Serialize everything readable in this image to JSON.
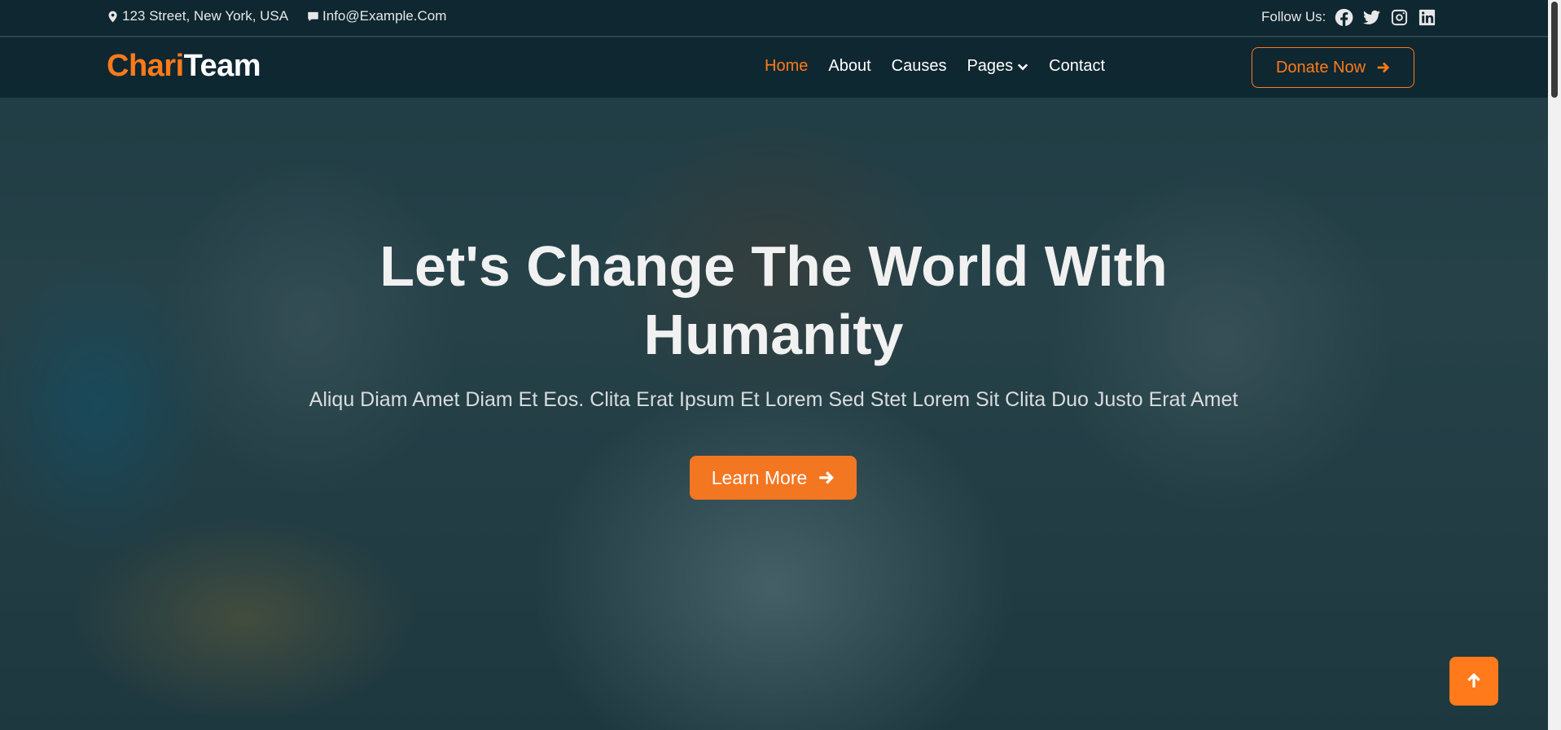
{
  "topbar": {
    "address": "123 Street, New York, USA",
    "email": "Info@Example.Com",
    "follow_label": "Follow Us:"
  },
  "logo": {
    "part1": "Chari",
    "part2": "Team"
  },
  "nav": {
    "home": "Home",
    "about": "About",
    "causes": "Causes",
    "pages": "Pages",
    "contact": "Contact",
    "donate": "Donate Now"
  },
  "hero": {
    "title": "Let's Change The World With Humanity",
    "subtitle": "Aliqu Diam Amet Diam Et Eos. Clita Erat Ipsum Et Lorem Sed Stet Lorem Sit Clita Duo Justo Erat Amet",
    "cta": "Learn More"
  },
  "colors": {
    "accent": "#ff7a1a",
    "dark": "#0d2630"
  }
}
